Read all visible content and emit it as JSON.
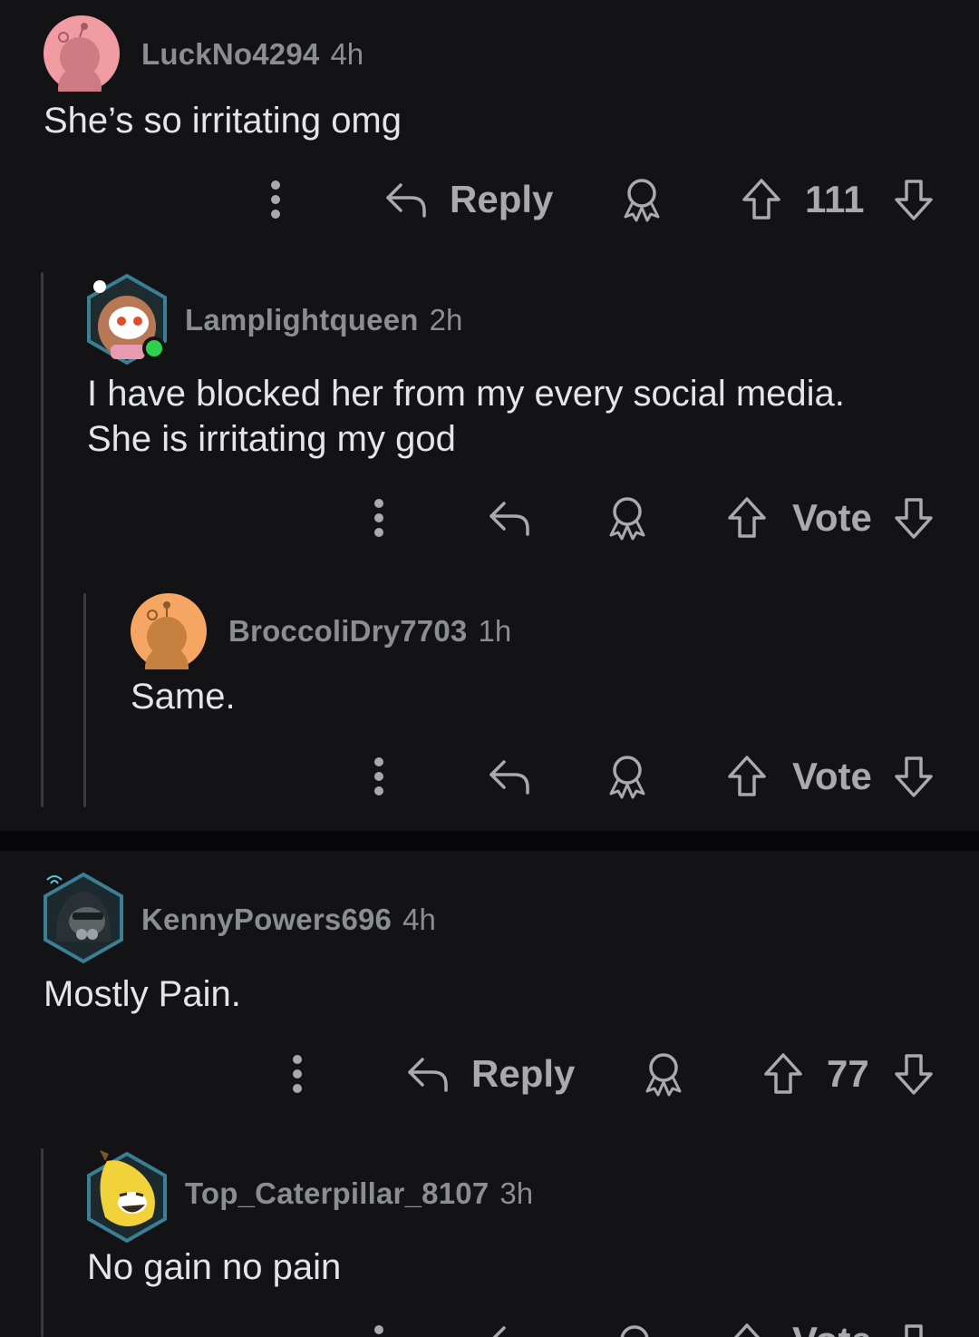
{
  "threads": [
    {
      "comments": [
        {
          "username": "LuckNo4294",
          "time": "4h",
          "text": "She’s so irritating omg",
          "avatar": "snoo-pink-avatar",
          "reply_label": "Reply",
          "score": "111"
        },
        {
          "username": "Lamplightqueen",
          "time": "2h",
          "lines": [
            "I have blocked her from my every social media.",
            "She is irritating my god"
          ],
          "avatar": "snoo-girl-avatar",
          "score": "Vote"
        },
        {
          "username": "BroccoliDry7703",
          "time": "1h",
          "text": "Same.",
          "avatar": "snoo-orange-avatar",
          "score": "Vote"
        }
      ]
    },
    {
      "comments": [
        {
          "username": "KennyPowers696",
          "time": "4h",
          "text": "Mostly Pain.",
          "avatar": "snoo-hooded-avatar",
          "reply_label": "Reply",
          "score": "77"
        },
        {
          "username": "Top_Caterpillar_8107",
          "time": "3h",
          "text": "No gain no pain",
          "avatar": "snoo-banana-avatar",
          "score": "Vote"
        }
      ]
    }
  ],
  "icons": {
    "more": "more-vertical-icon",
    "reply": "reply-arrow-icon",
    "award": "award-icon",
    "upvote": "upvote-arrow-icon",
    "downvote": "downvote-arrow-icon"
  },
  "colors": {
    "background": "#131315",
    "text": "#e3e5e8",
    "meta": "#8a8d91",
    "icon": "#a8aaad",
    "online": "#2ed14b",
    "pink_avatar": "#f19ba3",
    "orange_avatar": "#f5a662"
  }
}
